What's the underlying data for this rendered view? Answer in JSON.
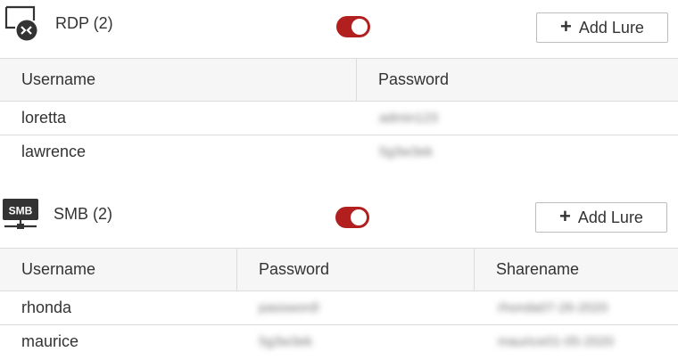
{
  "rdp": {
    "title": "RDP (2)",
    "icon": "remote-desktop-icon",
    "toggle_on": true,
    "add_button": "Add Lure",
    "columns": [
      "Username",
      "Password"
    ],
    "rows": [
      {
        "username": "loretta",
        "password": "admin123"
      },
      {
        "username": "lawrence",
        "password": "5g3w3ek"
      }
    ]
  },
  "smb": {
    "title": "SMB (2)",
    "icon": "smb-share-icon",
    "icon_label": "SMB",
    "toggle_on": true,
    "add_button": "Add Lure",
    "columns": [
      "Username",
      "Password",
      "Sharename"
    ],
    "rows": [
      {
        "username": "rhonda",
        "password": "password!",
        "sharename": "rhonda07-26-2020"
      },
      {
        "username": "maurice",
        "password": "5g3w3ek",
        "sharename": "maurice01-05-2020"
      }
    ]
  },
  "colors": {
    "toggle_active": "#b11f1f",
    "header_bg": "#f6f6f6",
    "border": "#dcdcdc"
  }
}
